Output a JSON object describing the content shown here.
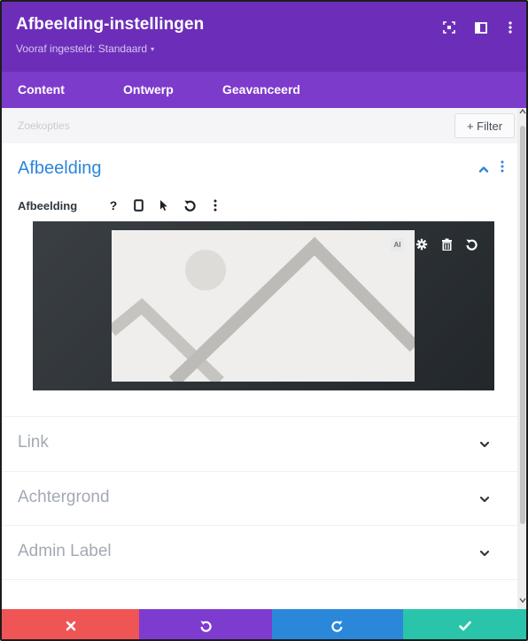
{
  "header": {
    "title": "Afbeelding-instellingen",
    "preset_label": "Vooraf ingesteld: Standaard",
    "preset_caret": "▾",
    "bg_color": "#6c2eb9",
    "icons": [
      "fullscreen-icon",
      "split-view-icon",
      "more-options-icon"
    ]
  },
  "tabs": [
    {
      "label": "Content",
      "active": true
    },
    {
      "label": "Ontwerp",
      "active": false
    },
    {
      "label": "Geavanceerd",
      "active": false
    }
  ],
  "search": {
    "placeholder": "Zoekopties",
    "filter_label": "+ Filter"
  },
  "section": {
    "title": "Afbeelding",
    "accent_color": "#2b87da",
    "field": {
      "label": "Afbeelding",
      "help_glyph": "?",
      "icons": [
        "help-icon",
        "responsive-icon",
        "hover-icon",
        "reset-icon",
        "more-options-icon"
      ]
    },
    "image_tools": {
      "ai_label": "AI",
      "icons": [
        "ai-icon",
        "settings-icon",
        "delete-icon",
        "reset-icon"
      ]
    }
  },
  "groups": [
    {
      "label": "Link"
    },
    {
      "label": "Achtergrond"
    },
    {
      "label": "Admin Label"
    }
  ],
  "footer": {
    "buttons": [
      {
        "name": "cancel",
        "glyph": "✖",
        "color": "#ef5555"
      },
      {
        "name": "undo",
        "color": "#7e3bd0"
      },
      {
        "name": "redo",
        "color": "#2b87da"
      },
      {
        "name": "save",
        "glyph": "✔",
        "color": "#29c4a9"
      }
    ]
  }
}
